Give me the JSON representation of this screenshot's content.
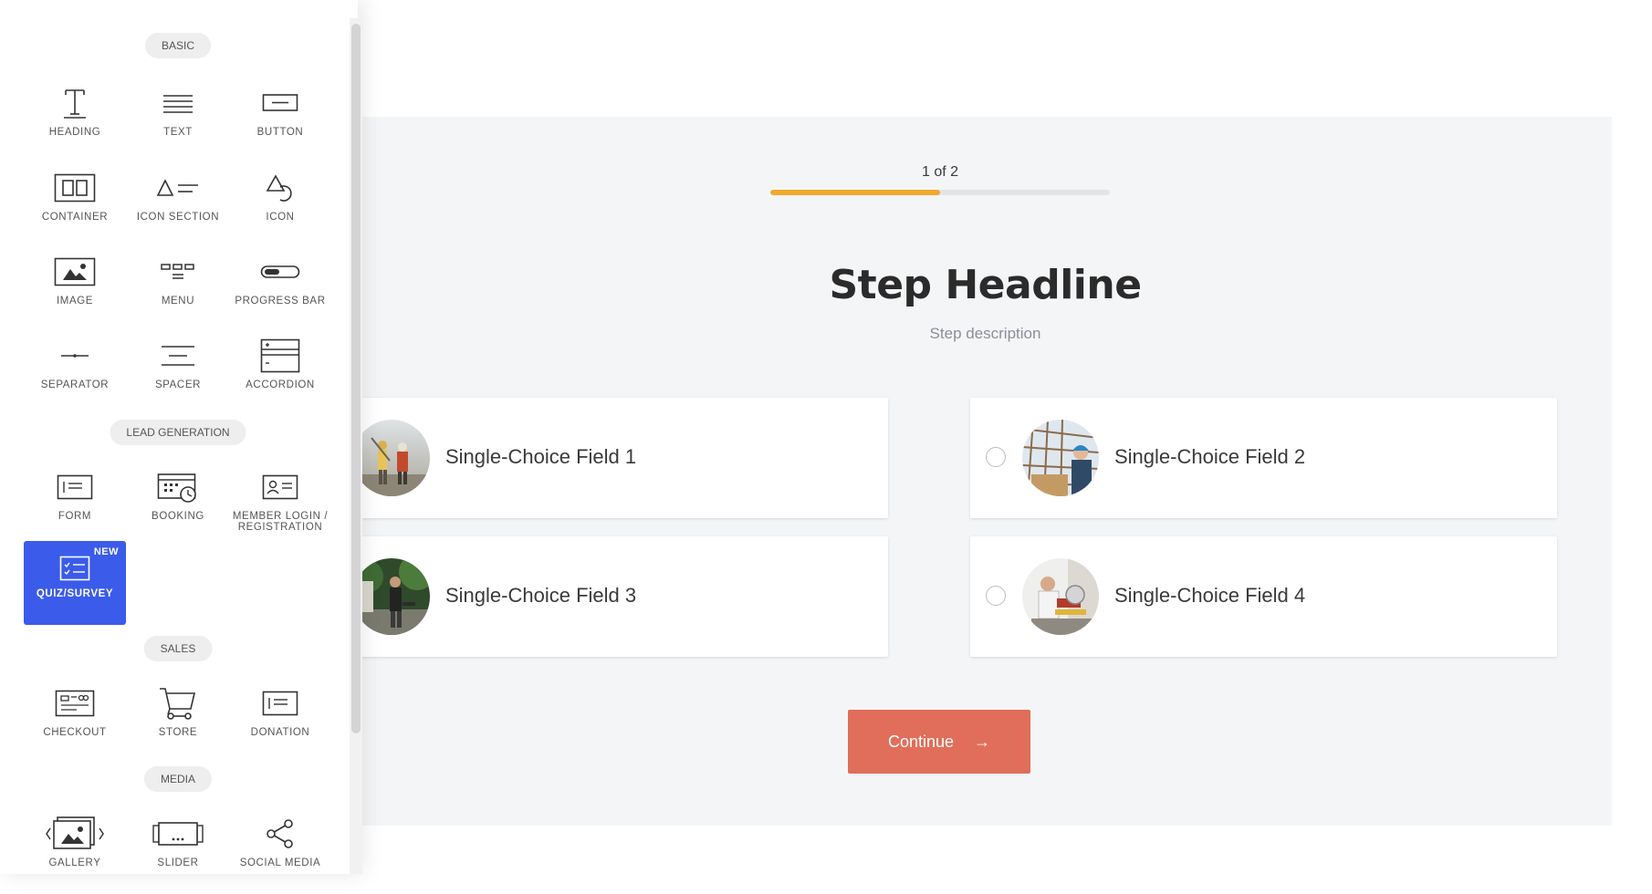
{
  "sidebar": {
    "sections": {
      "basic": "BASIC",
      "lead_generation": "LEAD GENERATION",
      "sales": "SALES",
      "media": "MEDIA"
    },
    "tools": {
      "heading": "HEADING",
      "text": "TEXT",
      "button": "BUTTON",
      "container": "CONTAINER",
      "icon_section": "ICON SECTION",
      "icon": "ICON",
      "image": "IMAGE",
      "menu": "MENU",
      "progress_bar": "PROGRESS BAR",
      "separator": "SEPARATOR",
      "spacer": "SPACER",
      "accordion": "ACCORDION",
      "form": "FORM",
      "booking": "BOOKING",
      "member_login_1": "MEMBER LOGIN /",
      "member_login_2": "REGISTRATION",
      "quiz_survey": "QUIZ/SURVEY",
      "new_badge": "NEW",
      "checkout": "CHECKOUT",
      "store": "STORE",
      "donation": "DONATION",
      "gallery": "GALLERY",
      "slider": "SLIDER",
      "social_media": "SOCIAL MEDIA"
    },
    "active_tool": "quiz_survey",
    "accent_color": "#3b5bea"
  },
  "quiz": {
    "progress_label": "1 of 2",
    "progress_fraction": 0.5,
    "progress_color": "#f0a92e",
    "headline": "Step Headline",
    "description": "Step description",
    "choices": [
      "Single-Choice Field 1",
      "Single-Choice Field 2",
      "Single-Choice Field 3",
      "Single-Choice Field 4"
    ],
    "continue_label": "Continue",
    "continue_arrow": "→",
    "continue_color": "#e06e5a"
  }
}
